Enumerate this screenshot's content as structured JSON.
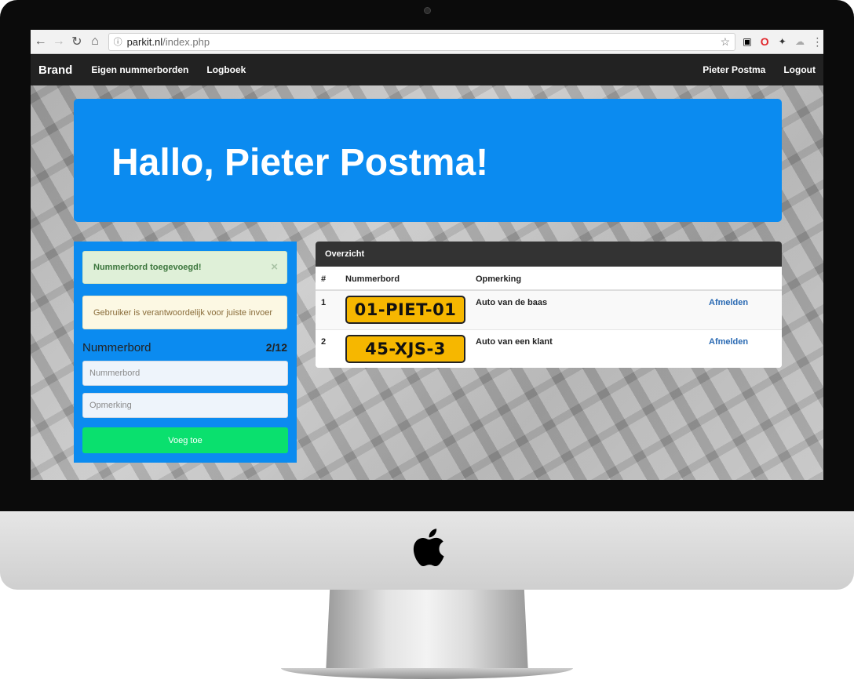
{
  "browser": {
    "url_host": "parkit.nl",
    "url_path": "/index.php",
    "back_icon": "arrow-left",
    "forward_icon": "arrow-right",
    "reload_icon": "reload",
    "home_icon": "home",
    "info_icon": "info-circle",
    "bookmark_icon": "star"
  },
  "navbar": {
    "brand": "Brand",
    "links": [
      "Eigen nummerborden",
      "Logboek"
    ],
    "user": "Pieter Postma",
    "logout": "Logout",
    "background": "#222222"
  },
  "hero": {
    "greeting": "Hallo, Pieter Postma!",
    "color": "#0b8bf0"
  },
  "form": {
    "success_message": "Nummerbord toegevoegd!",
    "close_symbol": "×",
    "warning_message": "Gebruiker is verantwoordelijk voor juiste invoer",
    "title": "Nummerbord",
    "count": "2/12",
    "plate_placeholder": "Nummerbord",
    "note_placeholder": "Opmerking",
    "submit_label": "Voeg toe",
    "submit_color": "#0ae06e"
  },
  "overview": {
    "title": "Overzicht",
    "headers": {
      "num": "#",
      "plate": "Nummerbord",
      "note": "Opmerking"
    },
    "rows": [
      {
        "num": "1",
        "plate": "01-PIET-01",
        "note": "Auto van de baas",
        "action": "Afmelden"
      },
      {
        "num": "2",
        "plate": "45-XJS-3",
        "note": "Auto van een klant",
        "action": "Afmelden"
      }
    ],
    "plate_color": "#f6b700",
    "action_color": "#2a6ab3"
  }
}
